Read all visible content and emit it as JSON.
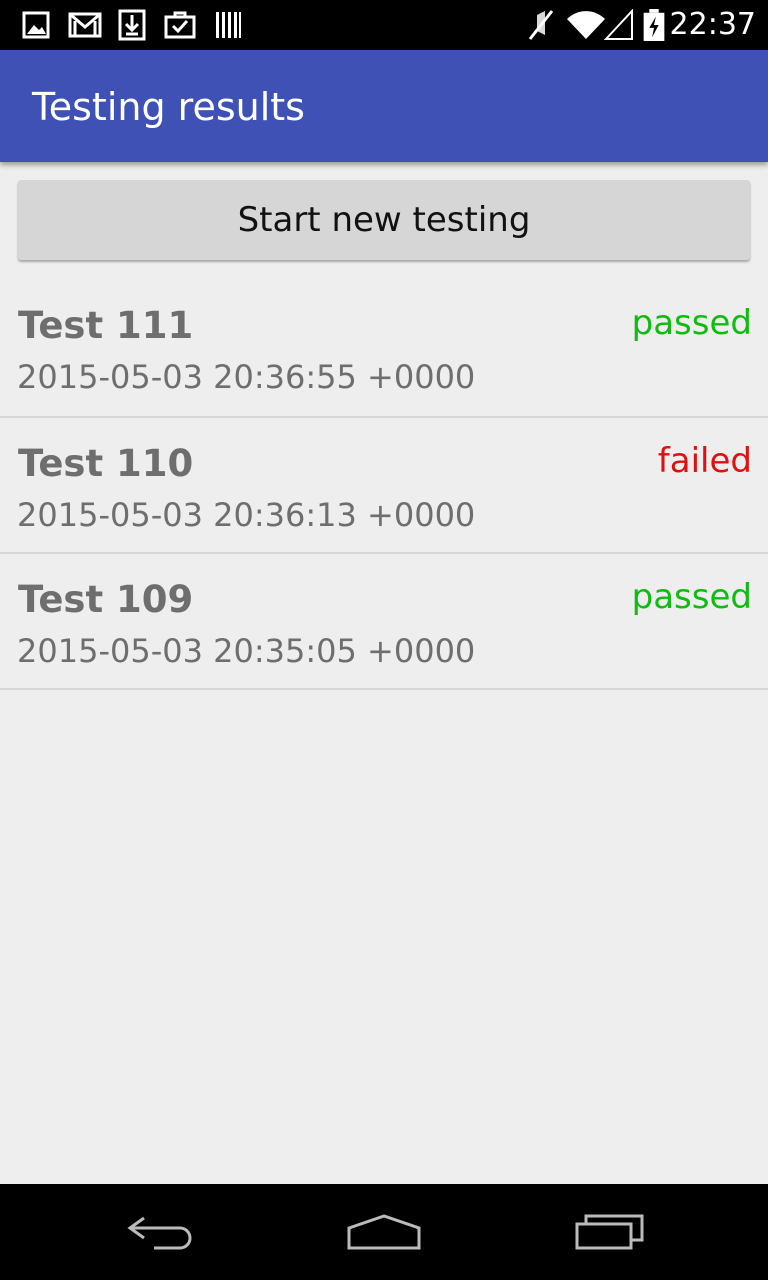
{
  "status_bar": {
    "time": "22:37",
    "icons": [
      "image-icon",
      "gmail-icon",
      "download-icon",
      "briefcase-check-icon",
      "barcode-icon",
      "mute-icon",
      "wifi-icon",
      "signal-icon",
      "battery-charging-icon"
    ]
  },
  "app_bar": {
    "title": "Testing results"
  },
  "start_button": {
    "label": "Start new testing"
  },
  "results": [
    {
      "name": "Test 111",
      "date": "2015-05-03 20:36:55 +0000",
      "status": "passed"
    },
    {
      "name": "Test 110",
      "date": "2015-05-03 20:36:13 +0000",
      "status": "failed"
    },
    {
      "name": "Test 109",
      "date": "2015-05-03 20:35:05 +0000",
      "status": "passed"
    }
  ],
  "colors": {
    "app_bar": "#3f51b5",
    "passed": "#11bb11",
    "failed": "#dd1111",
    "row_text": "#6e6e6e",
    "background": "#eeeeee"
  },
  "nav_bar": {
    "icons": [
      "back-icon",
      "home-icon",
      "recents-icon"
    ]
  }
}
